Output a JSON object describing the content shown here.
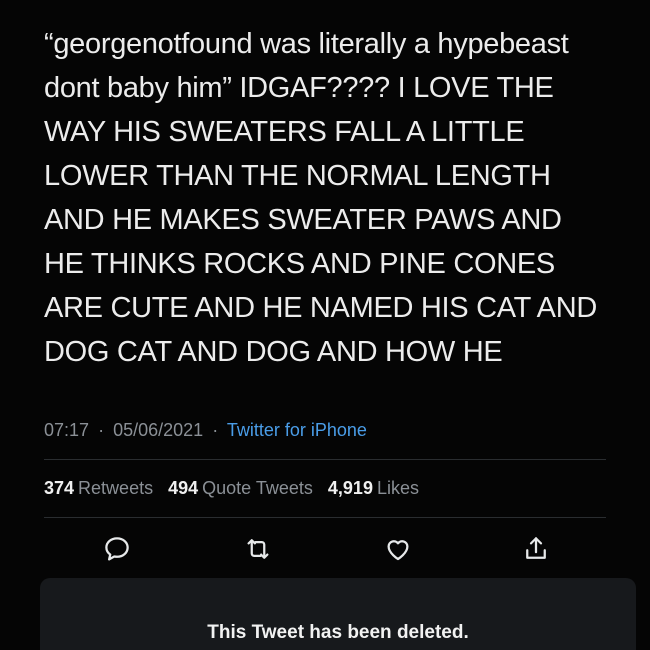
{
  "tweet": {
    "lines": [
      "“georgenotfound was literally a hypebeast",
      "dont baby him” IDGAF???? I LOVE THE",
      "WAY HIS SWEATERS FALL A LITTLE",
      "LOWER THAN THE NORMAL LENGTH",
      "AND HE MAKES SWEATER PAWS AND",
      "HE THINKS ROCKS AND PINE CONES",
      "ARE CUTE AND HE NAMED HIS CAT AND",
      "DOG CAT AND DOG AND HOW HE"
    ],
    "time": "07:17",
    "date": "05/06/2021",
    "separator": "·",
    "source": "Twitter for iPhone"
  },
  "stats": {
    "retweets_count": "374",
    "retweets_label": "Retweets",
    "quotes_count": "494",
    "quotes_label": "Quote Tweets",
    "likes_count": "4,919",
    "likes_label": "Likes"
  },
  "actions": {
    "icons": [
      "reply-icon",
      "retweet-icon",
      "like-icon",
      "share-icon"
    ]
  },
  "deleted_notice": {
    "text": "This Tweet has been deleted."
  },
  "colors": {
    "background": "#050505",
    "text": "#ececec",
    "muted": "#8b9096",
    "link": "#4a9de8",
    "notice_bg": "#17191c"
  }
}
